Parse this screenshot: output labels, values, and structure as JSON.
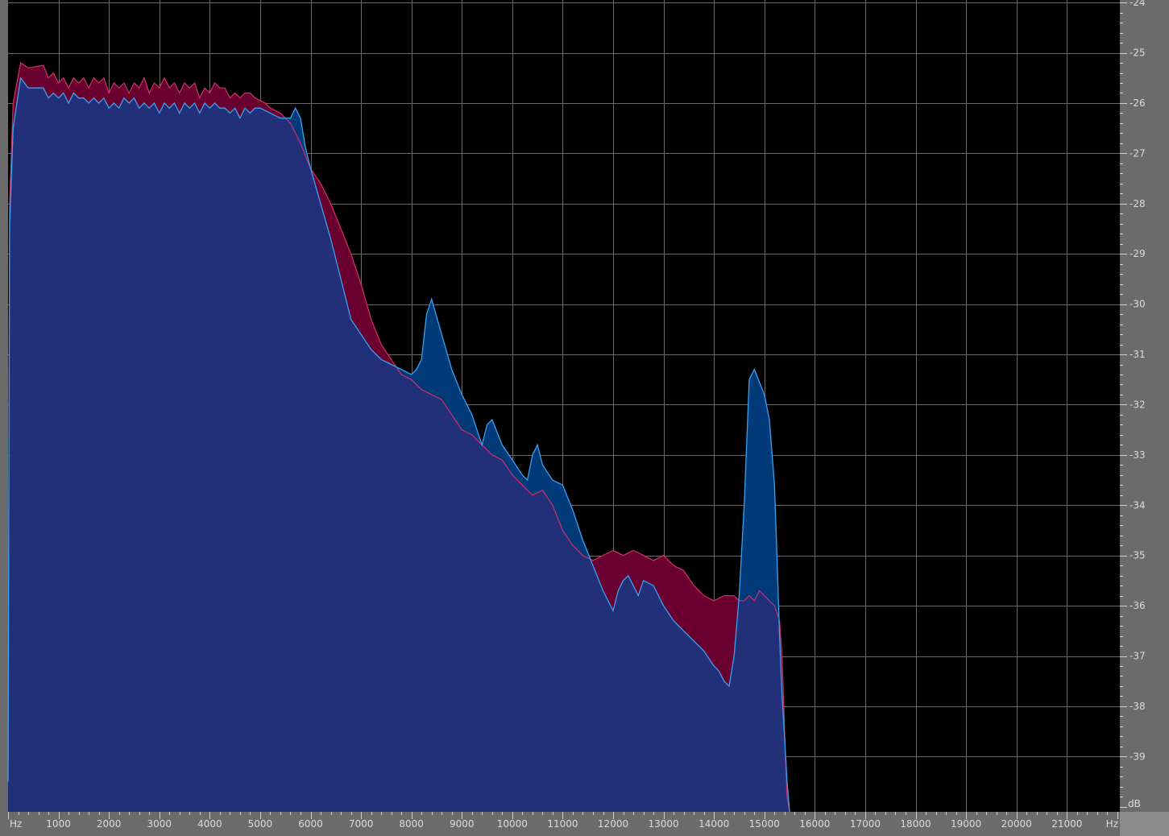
{
  "chart_data": {
    "type": "area",
    "x_unit": "Hz",
    "y_unit": "dB",
    "x_ticks": [
      1000,
      2000,
      3000,
      4000,
      5000,
      6000,
      7000,
      8000,
      9000,
      10000,
      11000,
      12000,
      13000,
      14000,
      15000,
      16000,
      17000,
      18000,
      19000,
      20000,
      21000
    ],
    "y_ticks": [
      -24,
      -25,
      -26,
      -27,
      -28,
      -29,
      -30,
      -31,
      -32,
      -33,
      -34,
      -35,
      -36,
      -37,
      -38,
      -39
    ],
    "xlim": [
      0,
      22050
    ],
    "ylim": [
      -40.1,
      -23.95
    ],
    "grid": true,
    "colors": {
      "background": "#000000",
      "grid": "#6a6a6a",
      "frame": "#6b6b6b",
      "series_a_fill": "#6a0030",
      "series_a_line": "#d0306a",
      "series_b_fill": "#22307a",
      "series_b_line": "#3aa0f0",
      "series_b_above": "#003a78"
    },
    "series": [
      {
        "x": [
          0,
          30,
          100,
          250,
          400,
          700,
          800,
          900,
          1000,
          1100,
          1200,
          1300,
          1400,
          1500,
          1600,
          1700,
          1800,
          1900,
          2000,
          2100,
          2200,
          2300,
          2400,
          2500,
          2600,
          2700,
          2800,
          2900,
          3000,
          3100,
          3200,
          3300,
          3400,
          3500,
          3600,
          3700,
          3800,
          3900,
          4000,
          4100,
          4200,
          4300,
          4400,
          4500,
          4600,
          4700,
          4800,
          4900,
          5000,
          5100,
          5200,
          5400,
          5600,
          5800,
          6000,
          6200,
          6400,
          6600,
          6800,
          7000,
          7200,
          7400,
          7600,
          7800,
          8000,
          8200,
          8400,
          8600,
          8800,
          9000,
          9200,
          9400,
          9600,
          9800,
          10000,
          10200,
          10400,
          10600,
          10800,
          11000,
          11200,
          11400,
          11600,
          11800,
          12000,
          12200,
          12400,
          12600,
          12800,
          13000,
          13200,
          13400,
          13600,
          13800,
          14000,
          14200,
          14400,
          14500,
          14600,
          14700,
          14800,
          14900,
          15000,
          15100,
          15200,
          15300,
          15350,
          15400,
          15450,
          15500
        ],
        "y": [
          -39.5,
          -28.0,
          -26.0,
          -25.2,
          -25.3,
          -25.25,
          -25.5,
          -25.4,
          -25.6,
          -25.5,
          -25.7,
          -25.5,
          -25.6,
          -25.5,
          -25.7,
          -25.5,
          -25.6,
          -25.5,
          -25.8,
          -25.6,
          -25.7,
          -25.6,
          -25.8,
          -25.6,
          -25.7,
          -25.5,
          -25.8,
          -25.6,
          -25.7,
          -25.5,
          -25.7,
          -25.6,
          -25.8,
          -25.6,
          -25.7,
          -25.6,
          -25.9,
          -25.7,
          -25.8,
          -25.6,
          -25.7,
          -25.7,
          -25.9,
          -25.8,
          -25.9,
          -25.8,
          -25.8,
          -25.9,
          -25.95,
          -26.0,
          -26.1,
          -26.2,
          -26.4,
          -26.8,
          -27.3,
          -27.6,
          -28.0,
          -28.5,
          -29.0,
          -29.6,
          -30.3,
          -30.8,
          -31.1,
          -31.4,
          -31.5,
          -31.7,
          -31.8,
          -31.9,
          -32.2,
          -32.5,
          -32.6,
          -32.8,
          -33.0,
          -33.1,
          -33.4,
          -33.6,
          -33.8,
          -33.7,
          -34.0,
          -34.5,
          -34.8,
          -35.0,
          -35.1,
          -35.0,
          -34.9,
          -35.0,
          -34.9,
          -35.0,
          -35.1,
          -35.0,
          -35.2,
          -35.3,
          -35.6,
          -35.8,
          -35.9,
          -35.8,
          -35.8,
          -35.9,
          -35.9,
          -35.8,
          -35.9,
          -35.7,
          -35.8,
          -35.9,
          -36.0,
          -36.3,
          -37.0,
          -38.5,
          -39.8,
          -40.1
        ]
      },
      {
        "x": [
          0,
          30,
          100,
          250,
          400,
          700,
          800,
          900,
          1000,
          1100,
          1200,
          1300,
          1400,
          1500,
          1600,
          1700,
          1800,
          1900,
          2000,
          2100,
          2200,
          2300,
          2400,
          2500,
          2600,
          2700,
          2800,
          2900,
          3000,
          3100,
          3200,
          3300,
          3400,
          3500,
          3600,
          3700,
          3800,
          3900,
          4000,
          4100,
          4200,
          4300,
          4400,
          4500,
          4600,
          4700,
          4800,
          4900,
          5000,
          5200,
          5400,
          5500,
          5600,
          5700,
          5800,
          5900,
          6000,
          6200,
          6400,
          6600,
          6800,
          7000,
          7200,
          7400,
          7600,
          7800,
          8000,
          8100,
          8200,
          8300,
          8400,
          8600,
          8800,
          9000,
          9200,
          9300,
          9400,
          9500,
          9600,
          9800,
          10000,
          10200,
          10300,
          10400,
          10500,
          10600,
          10800,
          11000,
          11200,
          11400,
          11600,
          11800,
          12000,
          12100,
          12200,
          12300,
          12400,
          12500,
          12600,
          12800,
          13000,
          13200,
          13400,
          13600,
          13800,
          14000,
          14100,
          14200,
          14300,
          14400,
          14500,
          14600,
          14700,
          14800,
          15000,
          15100,
          15200,
          15250,
          15300,
          15350,
          15400,
          15450,
          15500
        ],
        "y": [
          -39.5,
          -28.5,
          -26.5,
          -25.5,
          -25.7,
          -25.7,
          -25.9,
          -25.8,
          -25.9,
          -25.8,
          -26.0,
          -25.8,
          -25.9,
          -25.9,
          -26.0,
          -25.9,
          -26.0,
          -25.9,
          -26.1,
          -26.0,
          -26.1,
          -25.9,
          -26.0,
          -25.9,
          -26.1,
          -26.0,
          -26.1,
          -26.0,
          -26.2,
          -26.0,
          -26.1,
          -26.0,
          -26.2,
          -26.0,
          -26.1,
          -26.0,
          -26.2,
          -26.0,
          -26.1,
          -26.0,
          -26.1,
          -26.1,
          -26.2,
          -26.1,
          -26.3,
          -26.1,
          -26.2,
          -26.1,
          -26.1,
          -26.2,
          -26.3,
          -26.3,
          -26.3,
          -26.1,
          -26.3,
          -26.9,
          -27.3,
          -28.0,
          -28.7,
          -29.5,
          -30.3,
          -30.6,
          -30.9,
          -31.1,
          -31.2,
          -31.3,
          -31.4,
          -31.3,
          -31.1,
          -30.2,
          -29.9,
          -30.6,
          -31.3,
          -31.8,
          -32.2,
          -32.5,
          -32.8,
          -32.4,
          -32.3,
          -32.8,
          -33.1,
          -33.4,
          -33.5,
          -33.0,
          -32.8,
          -33.2,
          -33.5,
          -33.6,
          -34.1,
          -34.7,
          -35.2,
          -35.7,
          -36.1,
          -35.7,
          -35.5,
          -35.4,
          -35.6,
          -35.8,
          -35.5,
          -35.6,
          -36.0,
          -36.3,
          -36.5,
          -36.7,
          -36.9,
          -37.2,
          -37.3,
          -37.5,
          -37.6,
          -37.0,
          -35.8,
          -34.0,
          -31.5,
          -31.3,
          -31.8,
          -32.3,
          -33.6,
          -35.0,
          -36.6,
          -37.8,
          -38.6,
          -39.5,
          -40.1
        ]
      }
    ]
  }
}
